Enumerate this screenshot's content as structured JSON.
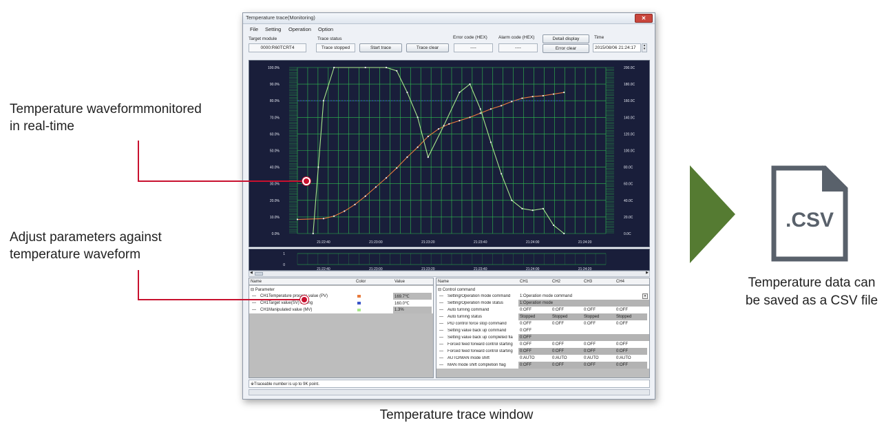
{
  "callouts": {
    "realtime": [
      "Temperature waveformmonitored",
      "in real-time"
    ],
    "adjust": [
      "Adjust parameters against",
      "temperature waveform"
    ],
    "csv": [
      "Temperature data can",
      "be saved as a CSV file"
    ]
  },
  "window_caption": "Temperature trace window",
  "csv_icon": {
    "extension": ".CSV",
    "icon": "csv-file-icon"
  },
  "colors": {
    "accent_red": "#c8102e",
    "arrow_green": "#557b32",
    "plot_bg": "#191e3a",
    "grid": "#2fbf4f",
    "pv": "#e87a3c",
    "sv": "#3a55c8",
    "mv": "#a9e88c"
  },
  "window": {
    "title": "Temperature trace(Monitoring)",
    "menu": [
      "File",
      "Setting",
      "Operation",
      "Option"
    ],
    "target_module_label": "Target module",
    "target_module_value": "0000:R60TCRT4",
    "trace_status_label": "Trace status",
    "trace_status_value": "Trace stopped",
    "start_trace": "Start trace",
    "trace_clear": "Trace clear",
    "error_code_label": "Error code (HEX)",
    "error_code_value": "----",
    "alarm_code_label": "Alarm code (HEX)",
    "alarm_code_value": "----",
    "detail_display": "Detail display",
    "error_clear": "Error clear",
    "time_label": "Time",
    "time_value": "2015/08/06 21:24:17",
    "note": "※Traceable number is up to 9K point."
  },
  "chart_data": {
    "type": "line",
    "x": [
      "21:22:30",
      "21:22:33",
      "21:22:36",
      "21:22:40",
      "21:22:44",
      "21:22:48",
      "21:22:52",
      "21:22:56",
      "21:23:00",
      "21:23:04",
      "21:23:08",
      "21:23:12",
      "21:23:16",
      "21:23:20",
      "21:23:24",
      "21:23:28",
      "21:23:32",
      "21:23:36",
      "21:23:40",
      "21:23:44",
      "21:23:48",
      "21:23:52",
      "21:23:56",
      "21:24:00",
      "21:24:04",
      "21:24:08",
      "21:24:12",
      "21:24:16",
      "21:24:20",
      "21:24:24",
      "21:24:28"
    ],
    "x_ticks": [
      "21:22:40",
      "21:23:00",
      "21:23:20",
      "21:23:40",
      "21:24:00",
      "21:24:20"
    ],
    "y_left_ticks": [
      "100.0%",
      "90.0%",
      "80.0%",
      "70.0%",
      "60.0%",
      "50.0%",
      "40.0%",
      "30.0%",
      "20.0%",
      "10.0%",
      "0.0%"
    ],
    "y_right_ticks": [
      "200.0C",
      "180.0C",
      "160.0C",
      "140.0C",
      "120.0C",
      "100.0C",
      "80.0C",
      "60.0C",
      "40.0C",
      "20.0C",
      "0.0C"
    ],
    "ylim_left": [
      0,
      100
    ],
    "ylim_right": [
      0,
      200
    ],
    "grid": true,
    "series": [
      {
        "name": "CH1Temperature process value (PV)",
        "axis": "right",
        "color": "#e87a3c",
        "points": [
          [
            "21:22:30",
            17
          ],
          [
            "21:22:40",
            18
          ],
          [
            "21:22:44",
            21
          ],
          [
            "21:22:48",
            27
          ],
          [
            "21:22:52",
            35
          ],
          [
            "21:22:56",
            45
          ],
          [
            "21:23:00",
            56
          ],
          [
            "21:23:04",
            67
          ],
          [
            "21:23:08",
            79
          ],
          [
            "21:23:12",
            92
          ],
          [
            "21:23:16",
            104
          ],
          [
            "21:23:20",
            117
          ],
          [
            "21:23:24",
            126
          ],
          [
            "21:23:28",
            132
          ],
          [
            "21:23:32",
            136
          ],
          [
            "21:23:36",
            140
          ],
          [
            "21:23:40",
            145
          ],
          [
            "21:23:44",
            150
          ],
          [
            "21:23:48",
            154
          ],
          [
            "21:23:52",
            159
          ],
          [
            "21:23:56",
            163
          ],
          [
            "21:24:00",
            165
          ],
          [
            "21:24:04",
            166
          ],
          [
            "21:24:08",
            168
          ],
          [
            "21:24:12",
            170
          ]
        ]
      },
      {
        "name": "CH1Target value(SV) setting",
        "axis": "right",
        "color": "#3a55c8",
        "points": [
          [
            "21:22:30",
            160
          ],
          [
            "21:24:12",
            160
          ]
        ]
      },
      {
        "name": "CH1Manipulated value (MV)",
        "axis": "left",
        "color": "#a9e88c",
        "points": [
          [
            "21:22:36",
            0
          ],
          [
            "21:22:38",
            40
          ],
          [
            "21:22:40",
            80
          ],
          [
            "21:22:44",
            100
          ],
          [
            "21:22:56",
            100
          ],
          [
            "21:23:04",
            100
          ],
          [
            "21:23:08",
            98
          ],
          [
            "21:23:12",
            85
          ],
          [
            "21:23:16",
            70
          ],
          [
            "21:23:20",
            46
          ],
          [
            "21:23:26",
            65
          ],
          [
            "21:23:32",
            85
          ],
          [
            "21:23:36",
            90
          ],
          [
            "21:23:40",
            75
          ],
          [
            "21:23:44",
            55
          ],
          [
            "21:23:48",
            36
          ],
          [
            "21:23:52",
            20
          ],
          [
            "21:23:56",
            15
          ],
          [
            "21:24:00",
            14
          ],
          [
            "21:24:04",
            15
          ],
          [
            "21:24:08",
            5
          ],
          [
            "21:24:12",
            0
          ]
        ]
      }
    ],
    "mini_y_ticks": [
      "1",
      "0"
    ]
  },
  "left_table": {
    "headers": [
      "Name",
      "Color",
      "Value"
    ],
    "group": "Parameter",
    "rows": [
      {
        "name": "CH1Temperature process value (PV)",
        "color": "#e87a3c",
        "value": "169.7℃"
      },
      {
        "name": "CH1Target value(SV) setting",
        "color": "#3a55c8",
        "value": "160.0℃"
      },
      {
        "name": "CH1Manipulated value (MV)",
        "color": "#a9e88c",
        "value": "1.3%"
      }
    ]
  },
  "right_table": {
    "headers": [
      "Name",
      "CH1",
      "CH2",
      "CH3",
      "CH4"
    ],
    "group": "Control command",
    "rows": [
      {
        "name": "Setting/Operation mode command",
        "cells": [
          "1:Operation mode command"
        ],
        "span": true,
        "dropdown": true,
        "shaded": false
      },
      {
        "name": "Setting/Operation mode status",
        "cells": [
          "1:Operation mode"
        ],
        "span": true,
        "shaded": true
      },
      {
        "name": "Auto turning command",
        "cells": [
          "0:OFF",
          "0:OFF",
          "0:OFF",
          "0:OFF"
        ],
        "shaded": false
      },
      {
        "name": "Auto turning status",
        "cells": [
          "Stopped",
          "Stopped",
          "Stopped",
          "Stopped"
        ],
        "shaded": true
      },
      {
        "name": "PID control force stop command",
        "cells": [
          "0:OFF",
          "0:OFF",
          "0:OFF",
          "0:OFF"
        ],
        "shaded": false
      },
      {
        "name": "Setting value back up command",
        "cells": [
          "0:OFF"
        ],
        "span": true,
        "shaded": false
      },
      {
        "name": "Setting value back up completed fla",
        "cells": [
          "0:OFF"
        ],
        "span": true,
        "shaded": true
      },
      {
        "name": "Forced feed forward control starting",
        "cells": [
          "0:OFF",
          "0:OFF",
          "0:OFF",
          "0:OFF"
        ],
        "shaded": false
      },
      {
        "name": "Forced feed forward control starting",
        "cells": [
          "0:OFF",
          "0:OFF",
          "0:OFF",
          "0:OFF"
        ],
        "shaded": true
      },
      {
        "name": "AUTO/MAN mode shift",
        "cells": [
          "0:AUTO",
          "0:AUTO",
          "0:AUTO",
          "0:AUTO"
        ],
        "shaded": false
      },
      {
        "name": "MAN mode shift completion flag",
        "cells": [
          "0:OFF",
          "0:OFF",
          "0:OFF",
          "0:OFF"
        ],
        "shaded": true
      }
    ]
  }
}
